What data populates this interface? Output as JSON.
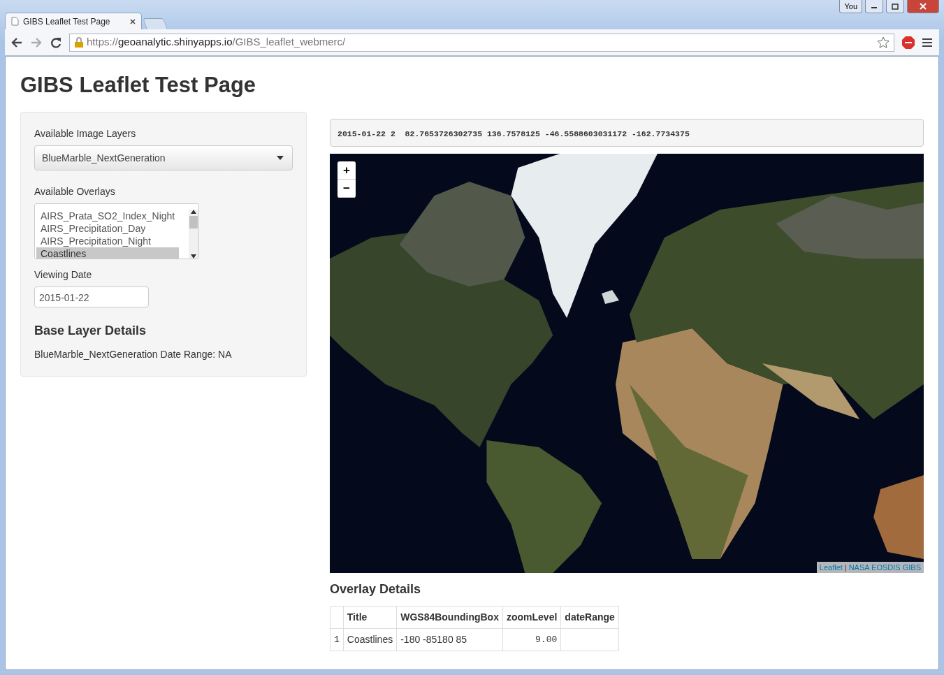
{
  "window": {
    "profile_button": "You"
  },
  "tabs": [
    {
      "label": "GIBS Leaflet Test Page",
      "selected": true
    }
  ],
  "address_bar": {
    "scheme": "https://",
    "host": "geoanalytic.shinyapps.io",
    "path": "/GIBS_leaflet_webmerc/"
  },
  "page": {
    "title": "GIBS Leaflet Test Page"
  },
  "sidebar": {
    "layers_label": "Available Image Layers",
    "layers_value": "BlueMarble_NextGeneration",
    "overlays_label": "Available Overlays",
    "overlays": [
      {
        "label": "AIRS_Prata_SO2_Index_Night",
        "selected": false
      },
      {
        "label": "AIRS_Precipitation_Day",
        "selected": false
      },
      {
        "label": "AIRS_Precipitation_Night",
        "selected": false
      },
      {
        "label": "Coastlines",
        "selected": true
      }
    ],
    "date_label": "Viewing Date",
    "date_value": "2015-01-22",
    "details_heading": "Base Layer Details",
    "details_text": "BlueMarble_NextGeneration Date Range: NA"
  },
  "info_text": "2015-01-22 2  82.7653726302735 136.7578125 -46.5588603031172 -162.7734375",
  "map": {
    "zoom_buttons": [
      "+",
      "−"
    ],
    "attribution": [
      {
        "text": "Leaflet",
        "kind": "link"
      },
      {
        "text": "|",
        "kind": "text"
      },
      {
        "text": "NASA EOSDIS GIBS",
        "kind": "link"
      }
    ]
  },
  "overlay_details": {
    "heading": "Overlay Details",
    "columns": [
      "Title",
      "WGS84BoundingBox",
      "zoomLevel",
      "dateRange"
    ],
    "rows": [
      {
        "index": "1",
        "cells": [
          "Coastlines",
          "-180 -85180 85",
          "9.00"
        ]
      }
    ]
  }
}
